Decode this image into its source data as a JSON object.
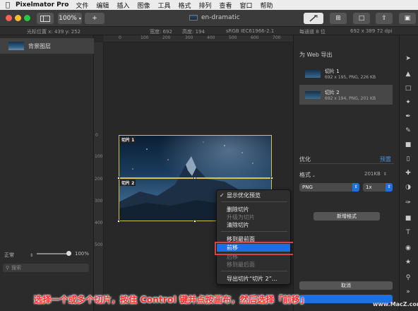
{
  "menubar": {
    "app_name": "Pixelmator Pro",
    "items": [
      "文件",
      "编辑",
      "插入",
      "图像",
      "工具",
      "格式",
      "排列",
      "查看",
      "窗口",
      "帮助"
    ]
  },
  "toolbar": {
    "zoom": "100%",
    "add_label": "+",
    "document_title": "en-dramatic"
  },
  "infobar": {
    "cursor_position": "光标位置 x:  439    y:  252",
    "width": "宽度:  692",
    "height": "高度:  194",
    "color_profile": "sRGB IEC61966-2.1",
    "bit_depth": "每通道 8 位",
    "dimensions": "692 x 389 72 dpi"
  },
  "layers": {
    "items": [
      {
        "label": "背景图层"
      }
    ],
    "blend_mode": "正常",
    "opacity": "100%",
    "search_placeholder": "搜索"
  },
  "rulers": {
    "top": [
      "0",
      "100",
      "200",
      "300",
      "400",
      "500",
      "600",
      "700"
    ],
    "left": [
      "0",
      "100",
      "200",
      "300",
      "400",
      "500"
    ]
  },
  "canvas": {
    "slices": [
      {
        "label": "切片 1"
      },
      {
        "label": "切片 2"
      }
    ]
  },
  "context_menu": {
    "items": [
      {
        "label": "显示优化预览",
        "checked": true,
        "enabled": true
      },
      {
        "label": "删除切片",
        "enabled": true
      },
      {
        "label": "升级为切片",
        "enabled": false
      },
      {
        "label": "清除切片",
        "enabled": true
      },
      {
        "label": "移到最前面",
        "enabled": true
      },
      {
        "label": "前移",
        "enabled": true,
        "highlighted": true
      },
      {
        "label": "后移",
        "enabled": false
      },
      {
        "label": "移到最后面",
        "enabled": false
      },
      {
        "label": "导出切片“切片 2”...",
        "enabled": true
      }
    ]
  },
  "export_panel": {
    "title": "为 Web 导出",
    "slices": [
      {
        "name": "切片 1",
        "info": "692 x 195, PNG, 226 KB",
        "selected": false
      },
      {
        "name": "切片 2",
        "info": "692 x 194, PNG, 201 KB",
        "selected": true
      }
    ],
    "optimize_label": "优化",
    "preset_label": "预置",
    "format_label": "格式",
    "file_size": "201KB",
    "format_value": "PNG",
    "scale_value": "1x",
    "add_format_label": "新增格式",
    "cancel_label": "取消"
  },
  "caption": "选择一个或多个切片，按住 Control 键并点按画布，然后选择「前移」",
  "watermark": "www.MacZ.com",
  "colors": {
    "highlight_blue": "#1d6fe2",
    "annotation_red": "#e0413b",
    "slice_border": "#d8c34a"
  }
}
